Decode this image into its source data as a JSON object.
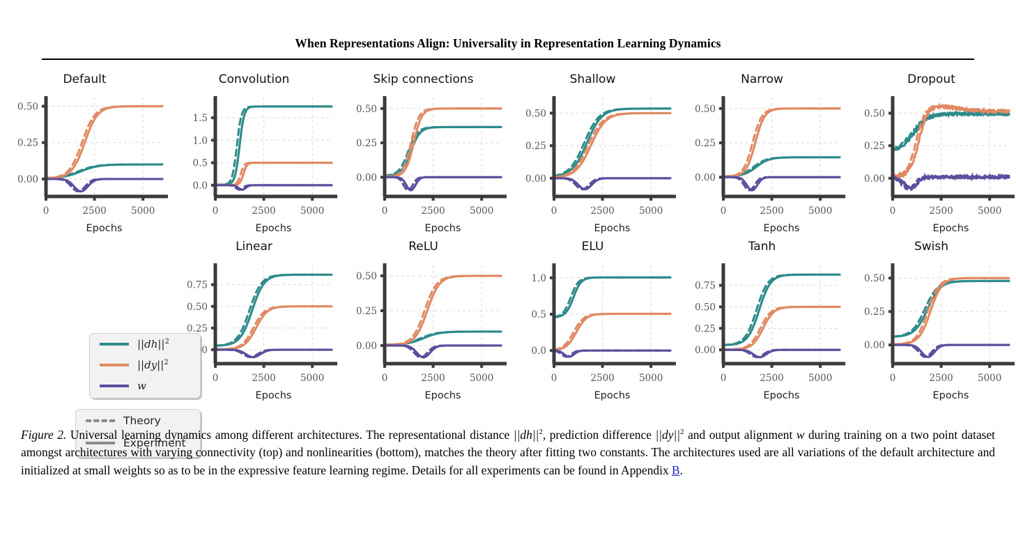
{
  "header": {
    "title": "When Representations Align: Universality in Representation Learning Dynamics"
  },
  "legend_series": {
    "items": [
      {
        "label_html": "||dh||<sup>2</sup>",
        "name": "dh-squared",
        "color": "#2E8B8B"
      },
      {
        "label_html": "||dy||<sup>2</sup>",
        "name": "dy-squared",
        "color": "#E08A63"
      },
      {
        "label_html": "w",
        "name": "w",
        "color": "#5B4E9E"
      }
    ]
  },
  "legend_style": {
    "items": [
      {
        "label": "Theory",
        "style": "dashed"
      },
      {
        "label": "Experiment",
        "style": "solid"
      }
    ]
  },
  "caption": {
    "lead": "Figure 2.",
    "text_1": " Universal learning dynamics among different architectures. The representational distance ",
    "math_1": "||dh||",
    "sup_1": "2",
    "text_2": ", prediction difference ",
    "math_2": "||dy||",
    "sup_2": "2",
    "text_3": " and output alignment ",
    "math_3": "w",
    "text_4": " during training on a two point dataset amongst architectures with varying connectivity (top) and nonlinearities (bottom), matches the theory after fitting two constants. The architectures used are all variations of the default architecture and initialized at small weights so as to be in the expressive feature learning regime. Details for all experiments can be found in Appendix ",
    "link": "B",
    "text_5": "."
  },
  "chart_data": {
    "type": "line",
    "figure_title": "Universal learning dynamics among different architectures",
    "xlabel": "Epochs",
    "ylabel": "",
    "xlim": [
      0,
      6000
    ],
    "xticks": [
      0,
      2500,
      5000
    ],
    "xticklabels": [
      "0",
      "2500",
      "5000"
    ],
    "grid": true,
    "legend_position": "left-middle",
    "series_names": [
      "||dh||^2",
      "||dy||^2",
      "w"
    ],
    "series_colors": [
      "#2E8B8B",
      "#E08A63",
      "#5B4E9E"
    ],
    "line_styles": {
      "experiment": "solid",
      "theory": "dashed"
    },
    "panels": [
      {
        "title": "Default",
        "row": "top",
        "col": 0,
        "ylim": [
          -0.12,
          0.56
        ],
        "yticks": [
          0.0,
          0.25,
          0.5
        ],
        "yticklabels": [
          "0.00",
          "0.25",
          "0.50"
        ],
        "noise": 0,
        "series": [
          {
            "name": "||dh||^2",
            "start": 0.005,
            "plateau": 0.1,
            "midpoint": 1800,
            "rate": 0.0022,
            "dip": 0
          },
          {
            "name": "||dy||^2",
            "start": 0.005,
            "plateau": 0.5,
            "midpoint": 2000,
            "rate": 0.003,
            "dip": 0
          },
          {
            "name": "w",
            "start": 0.0,
            "plateau": 0.0,
            "midpoint": 1750,
            "rate": 0.0035,
            "dip": -0.085,
            "dip_center": 1800,
            "dip_width": 500
          }
        ]
      },
      {
        "title": "Convolution",
        "row": "top",
        "col": 1,
        "ylim": [
          -0.25,
          1.95
        ],
        "yticks": [
          0.0,
          0.5,
          1.0,
          1.5
        ],
        "yticklabels": [
          "0.0",
          "0.5",
          "1.0",
          "1.5"
        ],
        "noise": 0,
        "series": [
          {
            "name": "||dh||^2",
            "start": 0.01,
            "plateau": 1.75,
            "midpoint": 1250,
            "rate": 0.0085,
            "dip": 0
          },
          {
            "name": "||dy||^2",
            "start": 0.005,
            "plateau": 0.5,
            "midpoint": 1450,
            "rate": 0.011,
            "dip": 0
          },
          {
            "name": "w",
            "start": 0.0,
            "plateau": 0.0,
            "midpoint": 1300,
            "rate": 0.009,
            "dip": -0.1,
            "dip_center": 1380,
            "dip_width": 260
          }
        ]
      },
      {
        "title": "Skip connections",
        "row": "top",
        "col": 2,
        "ylim": [
          -0.14,
          0.58
        ],
        "yticks": [
          0.0,
          0.25,
          0.5
        ],
        "yticklabels": [
          "0.00",
          "0.25",
          "0.50"
        ],
        "noise": 0,
        "series": [
          {
            "name": "||dh||^2",
            "start": 0.01,
            "plateau": 0.365,
            "midpoint": 1350,
            "rate": 0.0042,
            "dip": 0
          },
          {
            "name": "||dy||^2",
            "start": 0.004,
            "plateau": 0.5,
            "midpoint": 1500,
            "rate": 0.0048,
            "dip": 0
          },
          {
            "name": "w",
            "start": 0.0,
            "plateau": 0.0,
            "midpoint": 1300,
            "rate": 0.005,
            "dip": -0.095,
            "dip_center": 1350,
            "dip_width": 330
          }
        ]
      },
      {
        "title": "Shallow",
        "row": "top",
        "col": 3,
        "ylim": [
          -0.14,
          0.62
        ],
        "yticks": [
          0.0,
          0.25,
          0.5
        ],
        "yticklabels": [
          "0.00",
          "0.25",
          "0.50"
        ],
        "noise": 0,
        "series": [
          {
            "name": "||dh||^2",
            "start": 0.01,
            "plateau": 0.535,
            "midpoint": 1700,
            "rate": 0.0026,
            "dip": 0
          },
          {
            "name": "||dy||^2",
            "start": 0.004,
            "plateau": 0.5,
            "midpoint": 1900,
            "rate": 0.0026,
            "dip": 0
          },
          {
            "name": "w",
            "start": 0.0,
            "plateau": 0.0,
            "midpoint": 1600,
            "rate": 0.0032,
            "dip": -0.085,
            "dip_center": 1600,
            "dip_width": 480
          }
        ]
      },
      {
        "title": "Narrow",
        "row": "top",
        "col": 4,
        "ylim": [
          -0.14,
          0.58
        ],
        "yticks": [
          0.0,
          0.25,
          0.5
        ],
        "yticklabels": [
          "0.00",
          "0.25",
          "0.50"
        ],
        "noise": 0,
        "series": [
          {
            "name": "||dh||^2",
            "start": 0.005,
            "plateau": 0.145,
            "midpoint": 1700,
            "rate": 0.003,
            "dip": 0
          },
          {
            "name": "||dy||^2",
            "start": 0.004,
            "plateau": 0.5,
            "midpoint": 1650,
            "rate": 0.0042,
            "dip": 0
          },
          {
            "name": "w",
            "start": 0.0,
            "plateau": 0.0,
            "midpoint": 1450,
            "rate": 0.0045,
            "dip": -0.095,
            "dip_center": 1480,
            "dip_width": 380
          }
        ]
      },
      {
        "title": "Dropout",
        "row": "top",
        "col": 5,
        "ylim": [
          -0.14,
          0.62
        ],
        "yticks": [
          0.0,
          0.25,
          0.5
        ],
        "yticklabels": [
          "0.00",
          "0.25",
          "0.50"
        ],
        "noise": 0.012,
        "series": [
          {
            "name": "||dh||^2",
            "start": 0.21,
            "plateau": 0.495,
            "midpoint": 1150,
            "rate": 0.0028,
            "dip": 0
          },
          {
            "name": "||dy||^2",
            "start": 0.0,
            "plateau": 0.515,
            "midpoint": 1350,
            "rate": 0.0044,
            "dip": 0,
            "overshoot": 0.04
          },
          {
            "name": "w",
            "start": 0.0,
            "plateau": 0.01,
            "midpoint": 1100,
            "rate": 0.0042,
            "dip": -0.085,
            "dip_center": 950,
            "dip_width": 420
          }
        ]
      },
      {
        "title": "Linear",
        "row": "bottom",
        "col": 1,
        "ylim": [
          -0.16,
          0.98
        ],
        "yticks": [
          0.0,
          0.25,
          0.5,
          0.75
        ],
        "yticklabels": [
          "0.00",
          "0.25",
          "0.50",
          "0.75"
        ],
        "noise": 0,
        "series": [
          {
            "name": "||dh||^2",
            "start": 0.045,
            "plateau": 0.865,
            "midpoint": 1900,
            "rate": 0.0032,
            "dip": 0
          },
          {
            "name": "||dy||^2",
            "start": 0.005,
            "plateau": 0.5,
            "midpoint": 2100,
            "rate": 0.0034,
            "dip": 0
          },
          {
            "name": "w",
            "start": 0.0,
            "plateau": 0.0,
            "midpoint": 1900,
            "rate": 0.0038,
            "dip": -0.085,
            "dip_center": 1950,
            "dip_width": 520
          }
        ]
      },
      {
        "title": "ReLU",
        "row": "bottom",
        "col": 2,
        "ylim": [
          -0.13,
          0.58
        ],
        "yticks": [
          0.0,
          0.25,
          0.5
        ],
        "yticklabels": [
          "0.00",
          "0.25",
          "0.50"
        ],
        "noise": 0,
        "series": [
          {
            "name": "||dh||^2",
            "start": 0.005,
            "plateau": 0.1,
            "midpoint": 2000,
            "rate": 0.0024,
            "dip": 0
          },
          {
            "name": "||dy||^2",
            "start": 0.004,
            "plateau": 0.5,
            "midpoint": 2200,
            "rate": 0.0032,
            "dip": 0
          },
          {
            "name": "w",
            "start": 0.0,
            "plateau": 0.0,
            "midpoint": 1950,
            "rate": 0.0036,
            "dip": -0.085,
            "dip_center": 2000,
            "dip_width": 480
          }
        ]
      },
      {
        "title": "ELU",
        "row": "bottom",
        "col": 3,
        "ylim": [
          -0.18,
          1.18
        ],
        "yticks": [
          0.0,
          0.5,
          1.0
        ],
        "yticklabels": [
          "0.0",
          "0.5",
          "1.0"
        ],
        "noise": 0,
        "series": [
          {
            "name": "||dh||^2",
            "start": 0.455,
            "plateau": 1.005,
            "midpoint": 1000,
            "rate": 0.005,
            "dip": 0
          },
          {
            "name": "||dy||^2",
            "start": 0.0,
            "plateau": 0.505,
            "midpoint": 1150,
            "rate": 0.0038,
            "dip": 0
          },
          {
            "name": "w",
            "start": 0.0,
            "plateau": 0.0,
            "midpoint": 900,
            "rate": 0.0048,
            "dip": -0.085,
            "dip_center": 780,
            "dip_width": 360
          }
        ]
      },
      {
        "title": "Tanh",
        "row": "bottom",
        "col": 4,
        "ylim": [
          -0.16,
          0.99
        ],
        "yticks": [
          0.0,
          0.25,
          0.5,
          0.75
        ],
        "yticklabels": [
          "0.00",
          "0.25",
          "0.50",
          "0.75"
        ],
        "noise": 0,
        "series": [
          {
            "name": "||dh||^2",
            "start": 0.055,
            "plateau": 0.875,
            "midpoint": 1850,
            "rate": 0.0034,
            "dip": 0
          },
          {
            "name": "||dy||^2",
            "start": 0.004,
            "plateau": 0.5,
            "midpoint": 2050,
            "rate": 0.0036,
            "dip": 0
          },
          {
            "name": "w",
            "start": 0.0,
            "plateau": 0.0,
            "midpoint": 1850,
            "rate": 0.004,
            "dip": -0.085,
            "dip_center": 1880,
            "dip_width": 470
          }
        ]
      },
      {
        "title": "Swish",
        "row": "bottom",
        "col": 5,
        "ylim": [
          -0.14,
          0.6
        ],
        "yticks": [
          0.0,
          0.25,
          0.5
        ],
        "yticklabels": [
          "0.00",
          "0.25",
          "0.50"
        ],
        "noise": 0,
        "series": [
          {
            "name": "||dh||^2",
            "start": 0.06,
            "plateau": 0.478,
            "midpoint": 1800,
            "rate": 0.003,
            "dip": 0
          },
          {
            "name": "||dy||^2",
            "start": 0.004,
            "plateau": 0.5,
            "midpoint": 1950,
            "rate": 0.0034,
            "dip": 0
          },
          {
            "name": "w",
            "start": 0.0,
            "plateau": 0.0,
            "midpoint": 1800,
            "rate": 0.0038,
            "dip": -0.09,
            "dip_center": 1820,
            "dip_width": 460
          }
        ]
      }
    ]
  }
}
